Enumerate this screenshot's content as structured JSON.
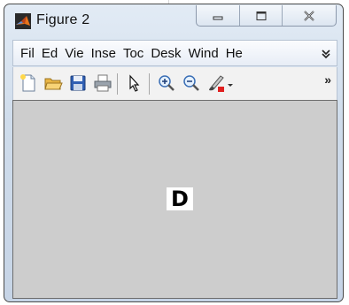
{
  "window": {
    "title": "Figure 2",
    "caption_buttons": [
      "minimize",
      "maximize",
      "close"
    ]
  },
  "menubar": {
    "items": [
      "Fil",
      "Ed",
      "Vie",
      "Inse",
      "Toc",
      "Desk",
      "Wind",
      "He"
    ],
    "overflow_icon": "menu-overflow-arrow"
  },
  "toolbar": {
    "buttons": [
      "new-figure-icon",
      "open-file-icon",
      "save-icon",
      "print-icon",
      "edit-plot-pointer-icon",
      "zoom-in-icon",
      "zoom-out-icon",
      "brush-icon",
      "brush-dropdown-icon"
    ],
    "more_label": "»"
  },
  "canvas": {
    "text": "D",
    "background": "#cdcdcd"
  },
  "colors": {
    "titlebar": "#cfdceb",
    "canvas": "#cdcdcd",
    "accent_brush": "#e02020"
  }
}
